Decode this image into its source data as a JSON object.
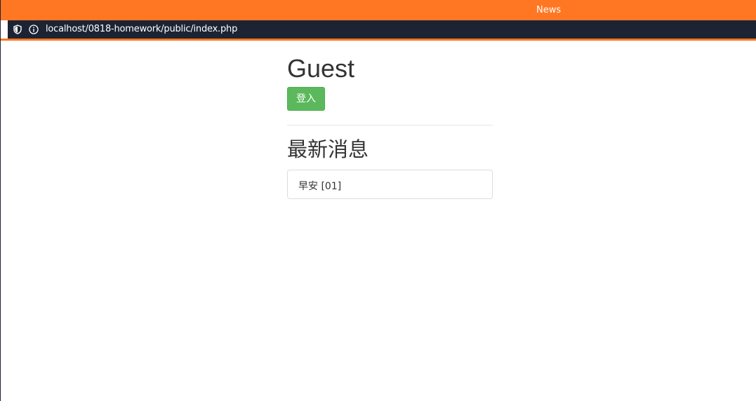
{
  "browser": {
    "title": "News",
    "url": "localhost/0818-homework/public/index.php",
    "shield_icon": "shield-icon",
    "info_icon": "info-icon",
    "accent_color": "#ff7722",
    "urlbar_color": "#1c2434"
  },
  "header": {
    "user_name": "Guest",
    "login_label": "登入",
    "login_color": "#5cb85c"
  },
  "news": {
    "title": "最新消息",
    "items": [
      {
        "label": "早安 [01]"
      }
    ]
  }
}
